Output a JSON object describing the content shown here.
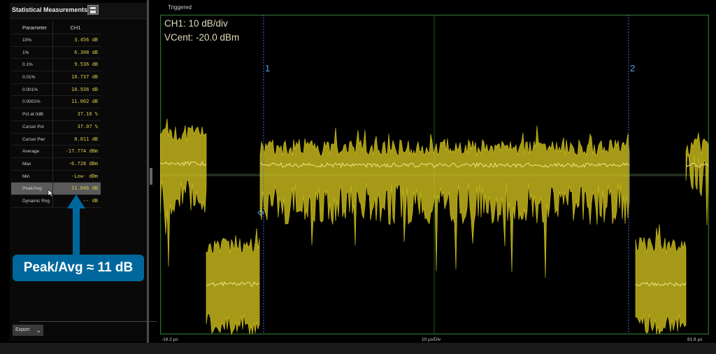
{
  "panel": {
    "title": "Statistical Measurements",
    "header_param": "Parameter",
    "header_ch": "CH1",
    "rows": [
      {
        "param": "10%",
        "value": "3.456 dB"
      },
      {
        "param": "1%",
        "value": "6.308 dB"
      },
      {
        "param": "0.1%",
        "value": "9.536 dB"
      },
      {
        "param": "0.01%",
        "value": "10.737 dB"
      },
      {
        "param": "0.001%",
        "value": "10.936 dB"
      },
      {
        "param": "0.0001%",
        "value": "11.002 dB"
      },
      {
        "param": "Pct at 0dB",
        "value": "37.16 %"
      },
      {
        "param": "Cursor Pct",
        "value": "37.07 %"
      },
      {
        "param": "Cursor Pwr",
        "value": "0.011 dB"
      },
      {
        "param": "Average",
        "value": "-17.774 dBm"
      },
      {
        "param": "Max",
        "value": "-6.728 dBm"
      },
      {
        "param": "Min",
        "value": "-Low- dBm"
      },
      {
        "param": "Peak/Avg",
        "value": "11.046 dB",
        "selected": true
      },
      {
        "param": "Dynamic Rng",
        "value": "-- dB"
      }
    ],
    "export_label": "Export"
  },
  "scope": {
    "status": "Triggered",
    "readout_ch1": "CH1: 10 dB/div",
    "readout_vcent": "VCent: -20.0 dBm",
    "cursor1_label": "1",
    "cursor2_label": "2",
    "xaxis_left": "-18.2 µs",
    "xaxis_mid": "10 µs/Div",
    "xaxis_right": "81.8 µs",
    "trace_color": "#d4c41e",
    "grid_color": "#1f5a1f",
    "cursor_color": "#3f6fd0"
  },
  "annotation": {
    "text": "Peak/Avg ≈ 11 dB",
    "color": "#00679c"
  }
}
